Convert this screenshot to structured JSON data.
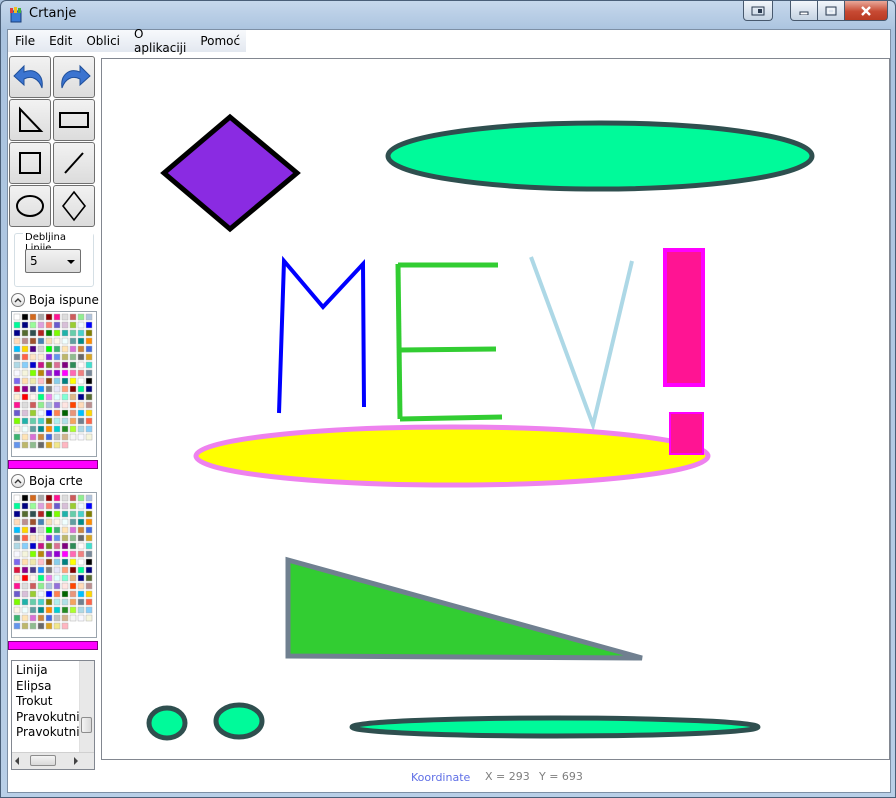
{
  "window": {
    "title": "Crtanje"
  },
  "menu": {
    "items": [
      "File",
      "Edit",
      "Oblici",
      "O aplikaciji",
      "Pomoć"
    ]
  },
  "toolbox": {
    "tools": [
      "undo-icon",
      "redo-icon",
      "right-triangle-icon",
      "rectangle-icon",
      "square-icon",
      "line-icon",
      "ellipse-icon",
      "diamond-icon"
    ]
  },
  "line_thickness": {
    "label": "Debljina Linije",
    "value": "5"
  },
  "fill_color": {
    "label": "Boja ispune",
    "selected": "#ff00ff"
  },
  "stroke_color": {
    "label": "Boja crte",
    "selected": "#ff00ff"
  },
  "shape_list": {
    "items": [
      "Linija",
      "Elipsa",
      "Trokut",
      "Pravokutnik",
      "Pravokutnik"
    ]
  },
  "status": {
    "label": "Koordinate",
    "x": "X = 293",
    "y": "Y = 693"
  },
  "canvas": {
    "diamond": {
      "fill": "#8a2be2",
      "stroke": "#000000"
    },
    "ellipse_top": {
      "fill": "#00fa9a",
      "stroke": "#2f4f4f"
    },
    "letter_m": {
      "stroke": "#0000ff"
    },
    "letter_e": {
      "stroke": "#32cd32"
    },
    "letter_v": {
      "stroke": "#add8e6"
    },
    "exclamation": {
      "fill": "#ff1493",
      "stroke": "#ff00ff"
    },
    "ellipse_yellow": {
      "fill": "#ffff00",
      "stroke": "#ee82ee"
    },
    "triangle": {
      "fill": "#32cd32",
      "stroke": "#708090"
    },
    "small_ellipses": {
      "fill": "#00fa9a",
      "stroke": "#2f4f4f"
    }
  }
}
